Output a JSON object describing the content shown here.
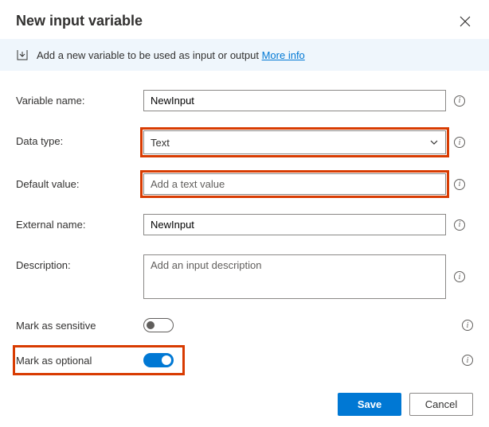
{
  "header": {
    "title": "New input variable"
  },
  "banner": {
    "text": "Add a new variable to be used as input or output",
    "link": "More info"
  },
  "fields": {
    "variableName": {
      "label": "Variable name:",
      "value": "NewInput"
    },
    "dataType": {
      "label": "Data type:",
      "value": "Text"
    },
    "defaultValue": {
      "label": "Default value:",
      "placeholder": "Add a text value"
    },
    "externalName": {
      "label": "External name:",
      "value": "NewInput"
    },
    "description": {
      "label": "Description:",
      "placeholder": "Add an input description"
    },
    "sensitive": {
      "label": "Mark as sensitive",
      "value": false
    },
    "optional": {
      "label": "Mark as optional",
      "value": true
    }
  },
  "footer": {
    "save": "Save",
    "cancel": "Cancel"
  }
}
